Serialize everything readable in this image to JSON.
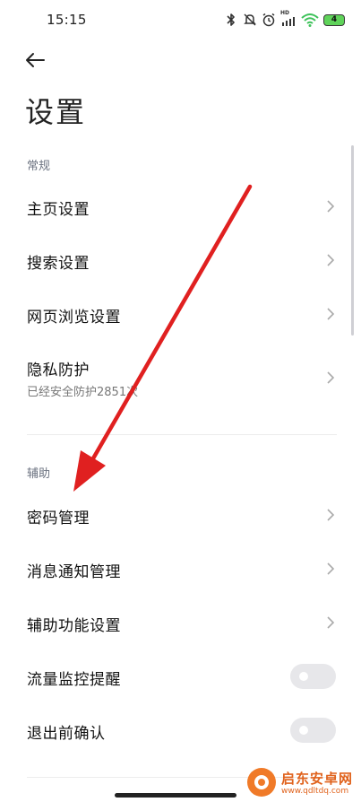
{
  "status_bar": {
    "time": "15:15",
    "hd_label": "HD",
    "battery": "4",
    "icons": [
      "bluetooth-icon",
      "mute-icon",
      "alarm-icon",
      "signal-icon",
      "wifi-icon",
      "battery-icon"
    ]
  },
  "header": {
    "back_icon": "arrow-left-icon",
    "title": "设置"
  },
  "sections": [
    {
      "header": "常规",
      "items": [
        {
          "label": "主页设置",
          "control": "chevron"
        },
        {
          "label": "搜索设置",
          "control": "chevron"
        },
        {
          "label": "网页浏览设置",
          "control": "chevron"
        },
        {
          "label": "隐私防护",
          "subtitle": "已经安全防护2851次",
          "control": "chevron"
        }
      ]
    },
    {
      "header": "辅助",
      "items": [
        {
          "label": "密码管理",
          "control": "chevron"
        },
        {
          "label": "消息通知管理",
          "control": "chevron"
        },
        {
          "label": "辅助功能设置",
          "control": "chevron"
        },
        {
          "label": "流量监控提醒",
          "control": "toggle",
          "on": false
        },
        {
          "label": "退出前确认",
          "control": "toggle",
          "on": false
        }
      ]
    }
  ],
  "annotation": {
    "arrow_color": "#e02020"
  },
  "watermark": {
    "title": "启东安卓网",
    "url": "www.qdltdq.com"
  },
  "colors": {
    "accent_battery": "#5fd35a",
    "wifi": "#3ec25a",
    "section_header": "#6b7280",
    "toggle_off": "#e7e7ea"
  }
}
